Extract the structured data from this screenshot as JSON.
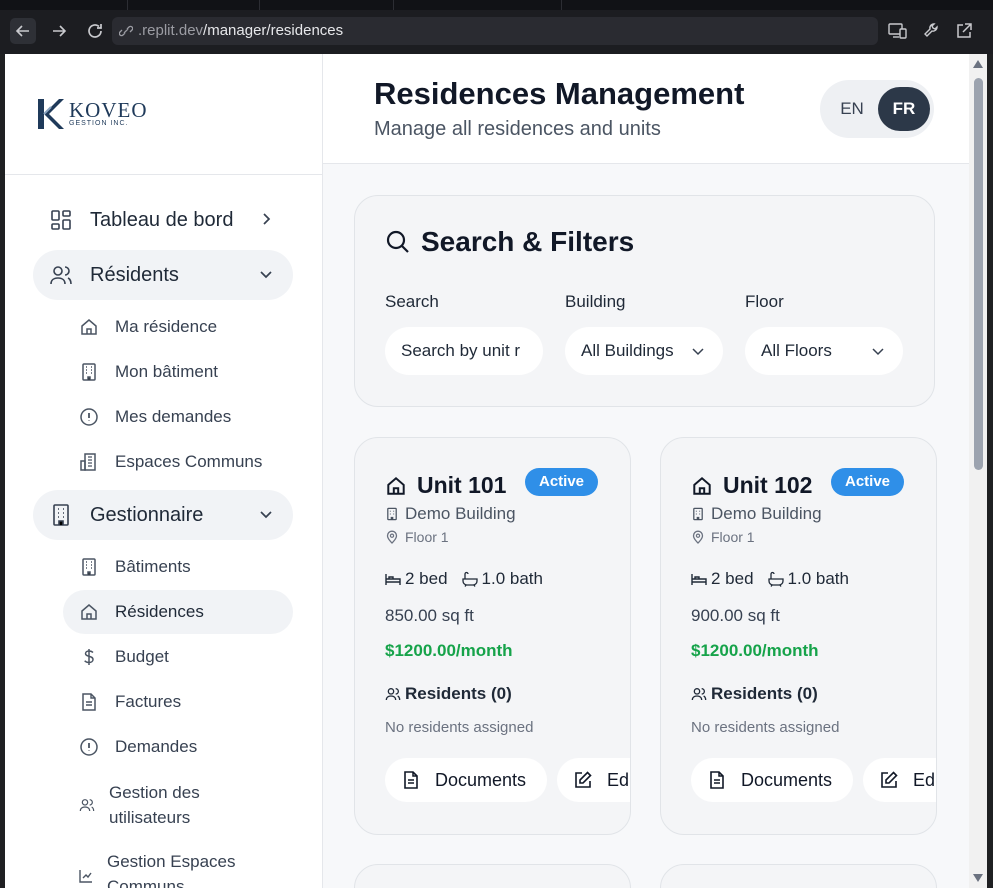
{
  "browser": {
    "url_host": ".replit.dev",
    "url_path": "/manager/residences"
  },
  "logo": {
    "name": "KOVEO",
    "tagline": "GESTION INC."
  },
  "sidebar": {
    "dashboard": "Tableau de bord",
    "residents_group": "Résidents",
    "residents_items": [
      "Ma résidence",
      "Mon bâtiment",
      "Mes demandes",
      "Espaces Communs"
    ],
    "manager_group": "Gestionnaire",
    "manager_items": [
      "Bâtiments",
      "Résidences",
      "Budget",
      "Factures",
      "Demandes",
      "Gestion des utilisateurs",
      "Gestion Espaces Communs"
    ],
    "active_item": "Résidences"
  },
  "header": {
    "title": "Residences Management",
    "subtitle": "Manage all residences and units",
    "lang_en": "EN",
    "lang_fr": "FR",
    "active_lang": "FR"
  },
  "filters": {
    "title": "Search & Filters",
    "search_label": "Search",
    "search_placeholder": "Search by unit r",
    "building_label": "Building",
    "building_value": "All Buildings",
    "floor_label": "Floor",
    "floor_value": "All Floors"
  },
  "units": [
    {
      "name": "Unit 101",
      "status": "Active",
      "building": "Demo Building",
      "floor": "Floor 1",
      "beds": "2 bed",
      "baths": "1.0 bath",
      "sqft": "850.00 sq ft",
      "rent": "$1200.00/month",
      "residents": "Residents (0)",
      "residents_note": "No residents assigned",
      "documents_btn": "Documents",
      "edit_btn": "Edit"
    },
    {
      "name": "Unit 102",
      "status": "Active",
      "building": "Demo Building",
      "floor": "Floor 1",
      "beds": "2 bed",
      "baths": "1.0 bath",
      "sqft": "900.00 sq ft",
      "rent": "$1200.00/month",
      "residents": "Residents (0)",
      "residents_note": "No residents assigned",
      "documents_btn": "Documents",
      "edit_btn": "Edit"
    }
  ],
  "colors": {
    "accent_dark": "#2c3848",
    "badge_blue": "#2f8fe8",
    "price_green": "#16a34a",
    "logo_navy": "#1f3a5a"
  }
}
